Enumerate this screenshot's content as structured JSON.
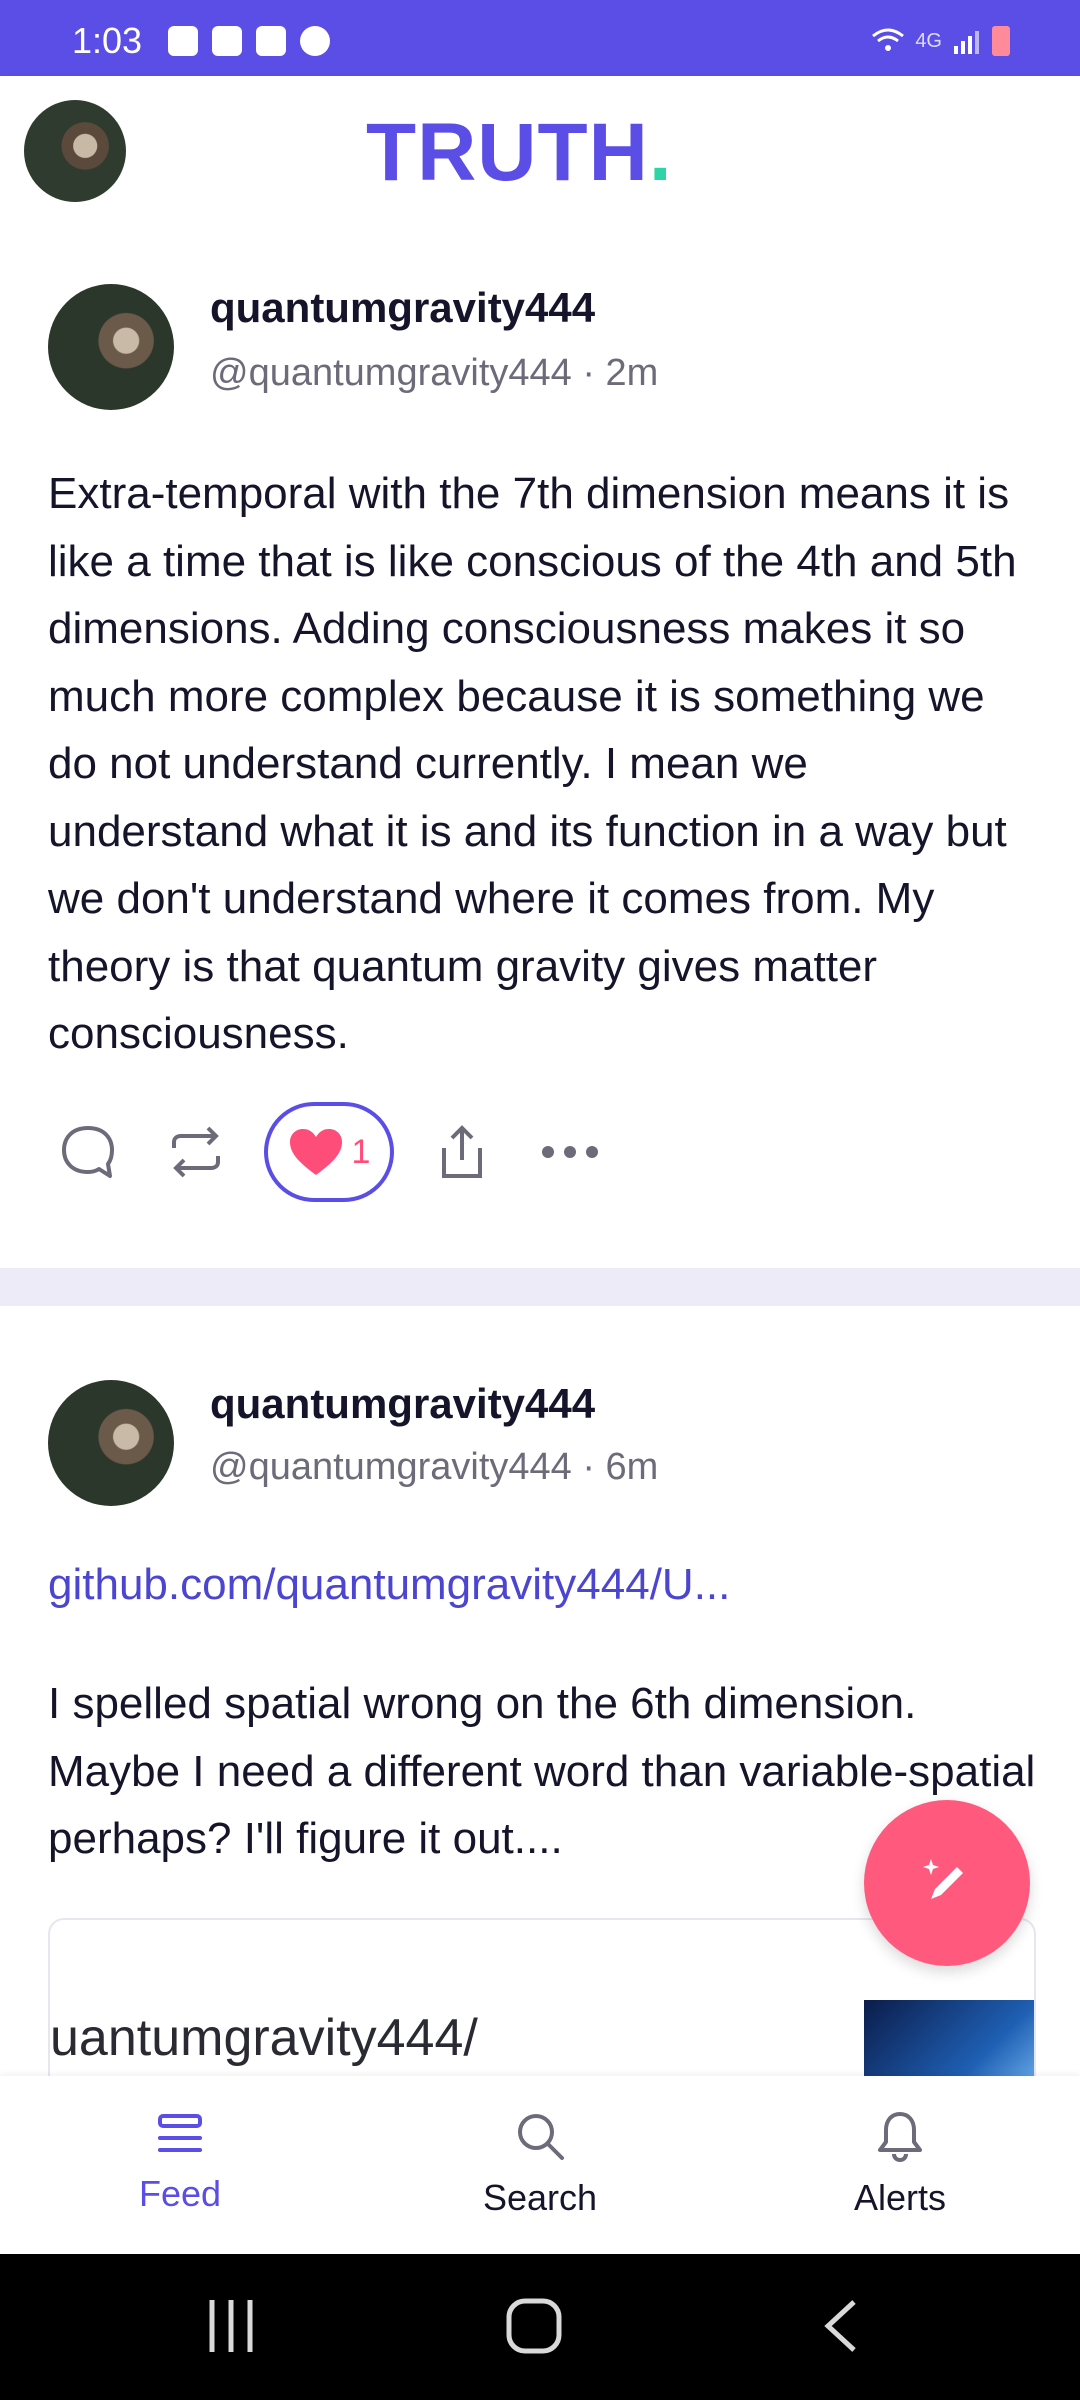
{
  "status_bar": {
    "time": "1:03",
    "network": "4G"
  },
  "header": {
    "logo_text": "TRUTH",
    "logo_dot": "."
  },
  "posts": [
    {
      "display_name": "quantumgravity444",
      "handle_line": "@quantumgravity444 · 2m",
      "text": "Extra-temporal with the 7th dimension means it is like a time that is like conscious of the 4th and 5th dimensions. Adding consciousness makes it so much more complex because it is something we do not understand currently. I mean we understand what it is and its function in a way but we don't understand where it comes from. My theory is that quantum gravity gives matter consciousness.",
      "like_count": "1"
    },
    {
      "display_name": "quantumgravity444",
      "handle_line": "@quantumgravity444 · 6m",
      "link_text": "github.com/quantumgravity444/U...",
      "text": "I spelled spatial wrong on the 6th dimension. Maybe I need a different word than variable-spatial perhaps? I'll figure it out....",
      "embed_text": "uantumgravity444/"
    }
  ],
  "bottom_nav": {
    "feed": "Feed",
    "search": "Search",
    "alerts": "Alerts"
  },
  "colors": {
    "accent": "#5a4ee6",
    "fab": "#ff5a7d",
    "like": "#ff4d7a",
    "link": "#4c45d1",
    "logo_dot": "#2ed3a6"
  },
  "icons": {
    "reply": "speech-bubble-icon",
    "repost": "repost-icon",
    "like": "heart-icon",
    "share": "share-icon",
    "more": "more-dots-icon",
    "compose": "pencil-sparkle-icon",
    "feed": "feed-icon",
    "search": "search-icon",
    "alerts": "bell-icon"
  }
}
